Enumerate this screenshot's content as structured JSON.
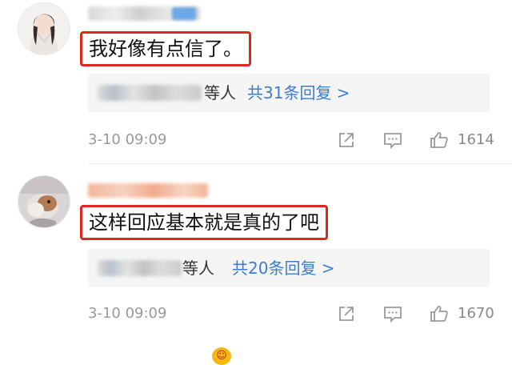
{
  "comments": [
    {
      "content": "我好像有点信了。",
      "reply_suffix": "等人",
      "reply_count": "共31条回复 >",
      "timestamp": "3-10 09:09",
      "likes": "1614"
    },
    {
      "content": "这样回应基本就是真的了吧",
      "reply_suffix": "等人",
      "reply_count": "共20条回复 >",
      "timestamp": "3-10 09:09",
      "likes": "1670"
    }
  ],
  "colors": {
    "highlight_border": "#e0281f",
    "link_blue": "#3c7cd0",
    "meta_gray": "#999999",
    "reply_bg": "#f5f5f5"
  },
  "icons": [
    "share-icon",
    "reply-icon",
    "like-icon"
  ]
}
